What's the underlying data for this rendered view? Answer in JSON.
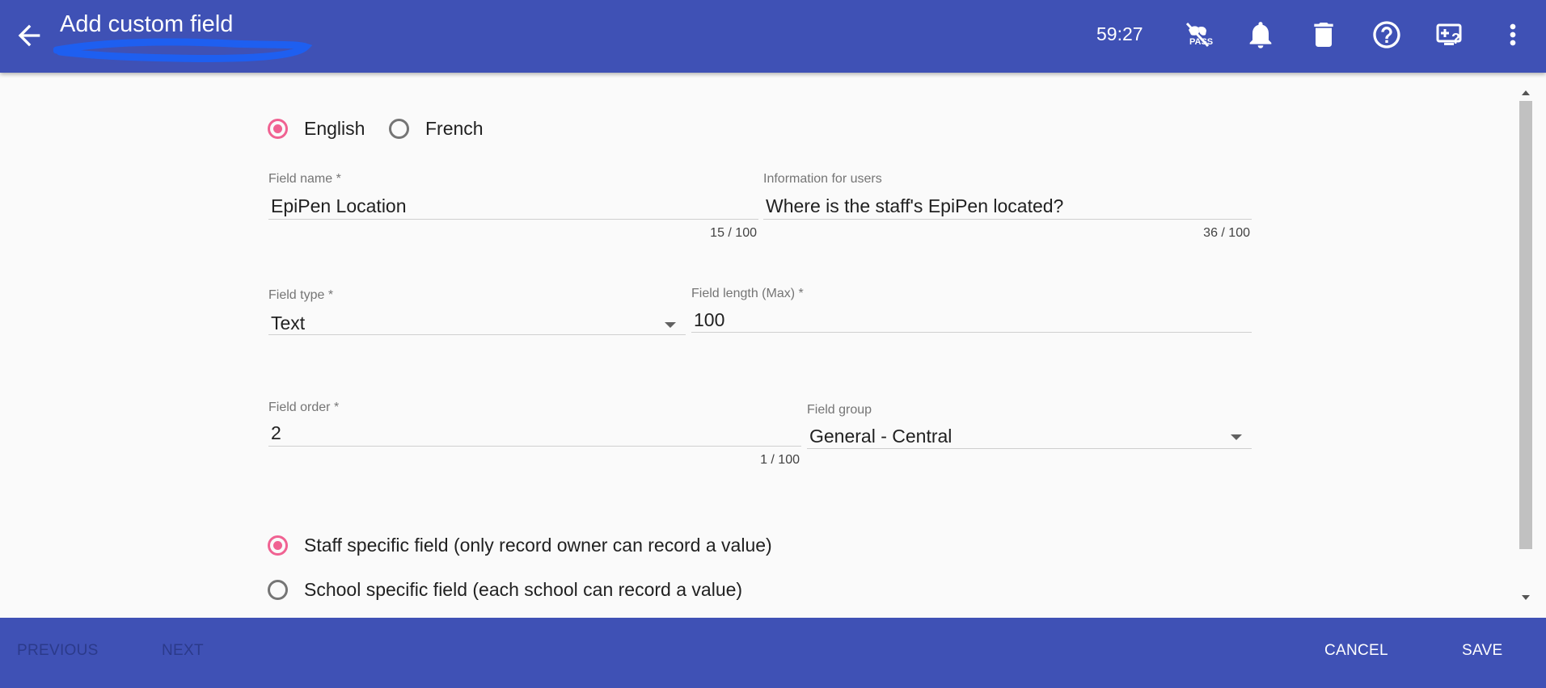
{
  "app_bar": {
    "title": "Add custom field",
    "timer": "59:27",
    "back_icon": "arrow-left-icon",
    "actions": [
      "pass-off-icon",
      "bell-icon",
      "trash-icon",
      "help-icon",
      "screen-help-icon",
      "more-vert-icon"
    ]
  },
  "language": {
    "options": [
      {
        "label": "English",
        "selected": true
      },
      {
        "label": "French",
        "selected": false
      }
    ]
  },
  "form": {
    "field_name": {
      "label": "Field name",
      "required_mark": "*",
      "value": "EpiPen Location",
      "counter": "15 / 100"
    },
    "information": {
      "label": "Information for users",
      "value": "Where is the staff's EpiPen located?",
      "counter": "36 / 100"
    },
    "field_type": {
      "label": "Field type",
      "required_mark": "*",
      "value": "Text"
    },
    "field_length": {
      "label": "Field length (Max)",
      "required_mark": "*",
      "value": "100"
    },
    "field_order": {
      "label": "Field order",
      "required_mark": "*",
      "value": "2",
      "counter": "1 / 100"
    },
    "field_group": {
      "label": "Field group",
      "value": "General - Central"
    }
  },
  "scope": {
    "options": [
      {
        "label": "Staff specific field (only record owner can record a value)",
        "selected": true
      },
      {
        "label": "School specific field (each school can record a value)",
        "selected": false
      }
    ]
  },
  "footer": {
    "previous": "PREVIOUS",
    "next": "NEXT",
    "cancel": "CANCEL",
    "save": "SAVE"
  },
  "colors": {
    "primary": "#3f51b5",
    "accent": "#f06292",
    "background": "#fafafa"
  }
}
